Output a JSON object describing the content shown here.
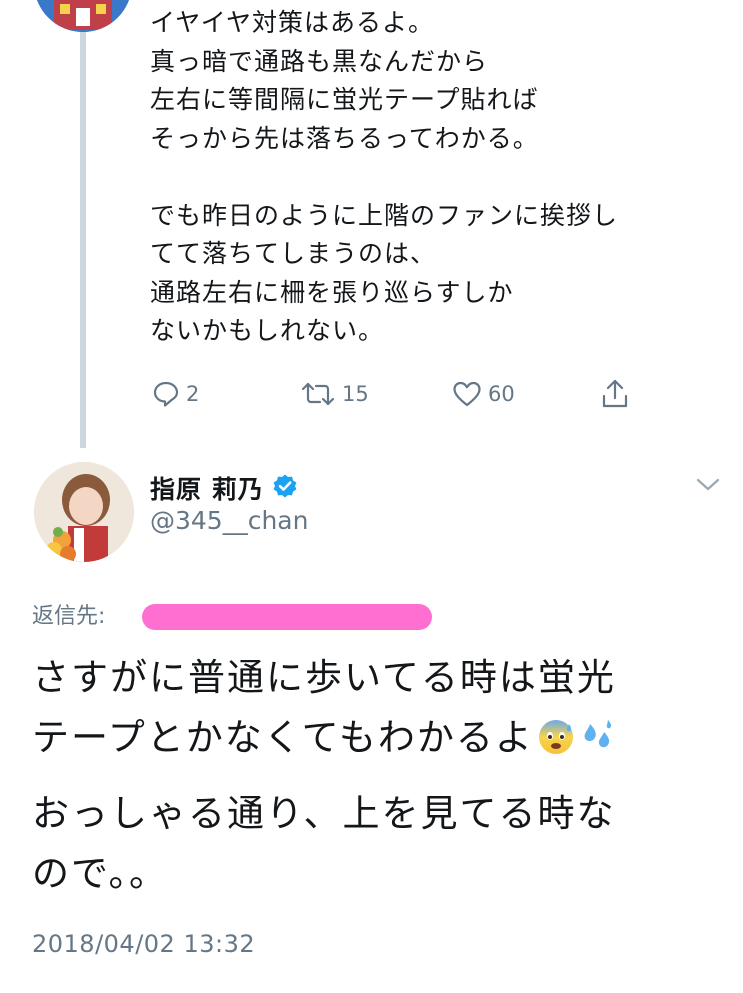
{
  "parent_tweet": {
    "paragraphs": [
      [
        "イヤイヤ対策はあるよ。",
        "真っ暗で通路も黒なんだから",
        "左右に等間隔に蛍光テープ貼れば",
        "そっから先は落ちるってわかる。"
      ],
      [
        "でも昨日のように上階のファンに挨拶し",
        "てて落ちてしまうのは、",
        "通路左右に柵を張り巡らすしか",
        "ないかもしれない。"
      ]
    ],
    "actions": {
      "reply_count": "2",
      "retweet_count": "15",
      "like_count": "60"
    }
  },
  "tweet": {
    "display_name": "指原 莉乃",
    "handle": "@345__chan",
    "verified": true,
    "reply_to_label": "返信先:",
    "text_lines_1": [
      "さすがに普通に歩いてる時は蛍光",
      "テープとかなくてもわかるよ"
    ],
    "emojis": [
      "anxious-face-with-sweat",
      "sweat-droplets"
    ],
    "text_lines_2": [
      "おっしゃる通り、上を見てる時な",
      "ので。。"
    ],
    "timestamp": "2018/04/02 13:32"
  },
  "colors": {
    "text": "#14171a",
    "secondary": "#657786",
    "thread_line": "#ccd6dd",
    "verified_badge": "#1da1f2",
    "redaction": "#ff6fd2"
  }
}
